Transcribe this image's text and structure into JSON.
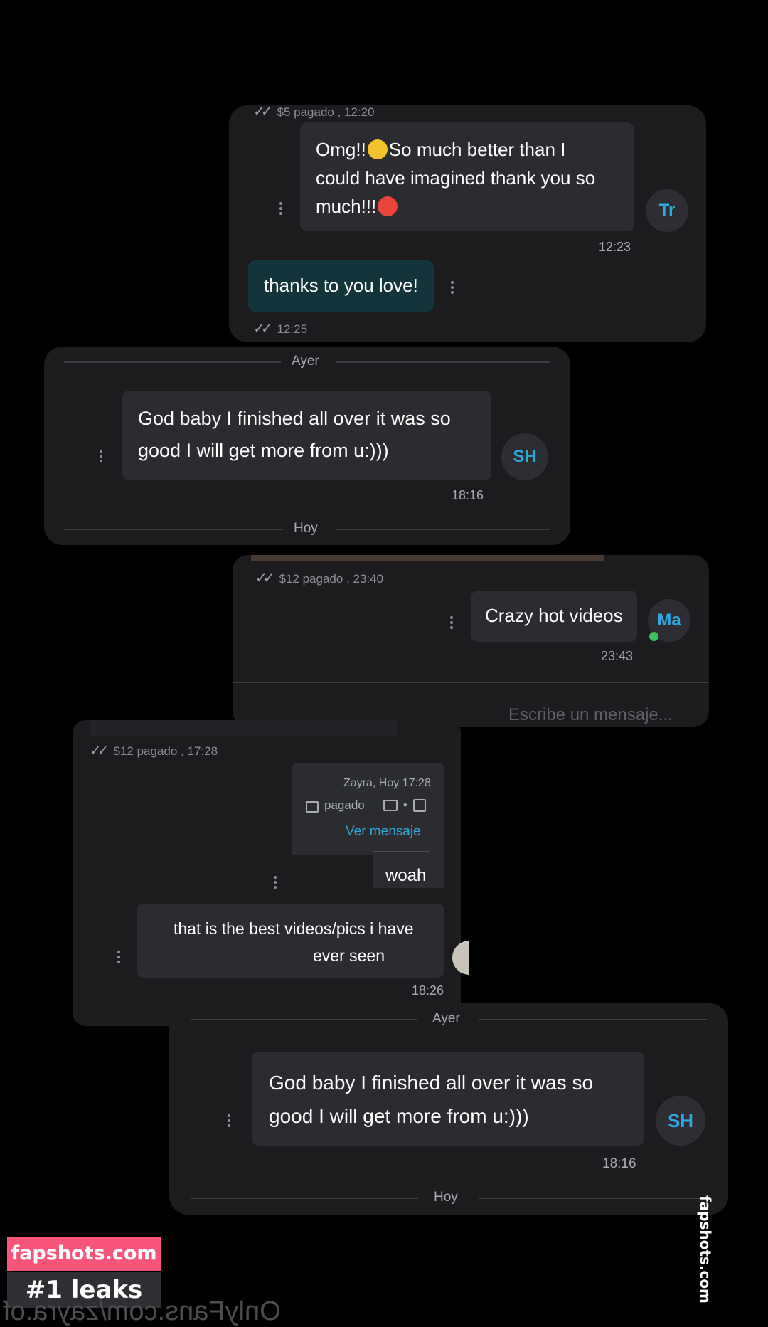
{
  "chat1": {
    "paid_label": "$5 pagado , 12:20",
    "avatar": "Tr",
    "message_line1": "Omg!!",
    "message_line1_tail": "So much better than I",
    "message_line2": "could have imagined thank you so",
    "message_line3": "much!!!",
    "message_time": "12:23",
    "reply": "thanks to you love!",
    "reply_time": "12:25"
  },
  "chat2": {
    "top_separator": "Ayer",
    "avatar": "SH",
    "message_line1": "God baby I finished all over it was so",
    "message_line2": "good I will get more from u:)))",
    "message_time": "18:16",
    "bottom_separator": "Hoy"
  },
  "chat3": {
    "paid_label": "$12 pagado , 23:40",
    "avatar": "Ma",
    "message": "Crazy hot videos",
    "message_time": "23:43",
    "input_placeholder": "Escribe un mensaje..."
  },
  "chat4": {
    "paid_label": "$12 pagado , 17:28",
    "card_sender": "Zayra, Hoy 17:28",
    "card_dot": "•",
    "card_status": "pagado",
    "card_link": "Ver mensaje",
    "message1": "woah",
    "message2_line1": "that is the best videos/pics i have",
    "message2_line2": "ever seen",
    "message_time": "18:26"
  },
  "chat5": {
    "top_separator": "Ayer",
    "avatar": "SH",
    "message_line1": "God baby I finished all over it was so",
    "message_line2": "good I will get more from u:)))",
    "message_time": "18:16",
    "bottom_separator": "Hoy"
  },
  "watermark": {
    "line1": "fapshots.com",
    "line2": "#1 leaks",
    "side": "fapshots.com",
    "bottom": "OnlyFans.com/zayra.of"
  },
  "colors": {
    "background": "#000000",
    "panel": "#1c1c1e",
    "bubble": "#2a2c30",
    "reply_bubble": "#12343b",
    "accent": "#2fa8e0",
    "brand_pink": "#f7557a"
  }
}
